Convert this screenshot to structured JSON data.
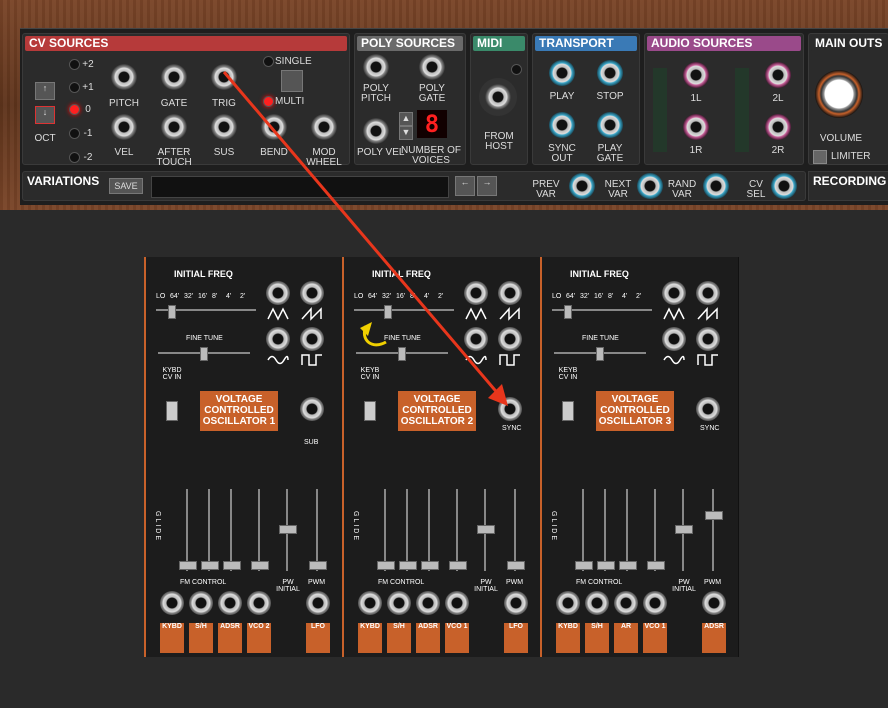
{
  "cv_sources": {
    "title": "CV SOURCES",
    "oct_label": "OCT",
    "oct_values": [
      "+2",
      "+1",
      "0",
      "-1",
      "-2"
    ],
    "oct_selected": "0",
    "row1": [
      "PITCH",
      "GATE",
      "TRIG"
    ],
    "row2": [
      "VEL",
      "AFTER TOUCH",
      "SUS",
      "BEND",
      "MOD WHEEL"
    ],
    "single_label": "SINGLE",
    "multi_label": "MULTI",
    "mode_selected": "MULTI"
  },
  "poly_sources": {
    "title": "POLY SOURCES",
    "jacks": [
      "POLY PITCH",
      "POLY GATE",
      "POLY VEL"
    ],
    "voices_label": "NUMBER OF VOICES",
    "voices_value": "8"
  },
  "midi": {
    "title": "MIDI",
    "from_host": "FROM HOST"
  },
  "transport": {
    "title": "TRANSPORT",
    "jacks": [
      "PLAY",
      "STOP",
      "SYNC OUT",
      "PLAY GATE"
    ]
  },
  "audio_sources": {
    "title": "AUDIO SOURCES",
    "jacks": [
      "1L",
      "2L",
      "1R",
      "2R"
    ]
  },
  "main_outs": {
    "title": "MAIN OUTS",
    "volume": "VOLUME",
    "limiter": "LIMITER"
  },
  "variations": {
    "title": "VARIATIONS",
    "save": "SAVE",
    "jacks": [
      "PREV VAR",
      "NEXT VAR",
      "RAND VAR",
      "CV SEL"
    ]
  },
  "recording": {
    "title": "RECORDING"
  },
  "colors": {
    "cv": "#b63a3a",
    "poly": "#6a6a6a",
    "midi": "#3a8a6a",
    "transport": "#3a7ab6",
    "audio": "#9a4a8a",
    "accent": "#c8612a",
    "arrow": "#e8361c",
    "yellow": "#f0d000"
  },
  "vco_panels": [
    {
      "initial_freq": "INITIAL FREQ",
      "ranges": [
        "LO",
        "64'",
        "32'",
        "16'",
        "8'",
        "4'",
        "2'"
      ],
      "fine_tune": "FINE TUNE",
      "kybd": "KYBD CV IN",
      "title": "VOLTAGE CONTROLLED OSCILLATOR 1",
      "extra": "SUB",
      "glide": "GLIDE",
      "fm_control": "FM CONTROL",
      "pw_initial": "PW INITIAL",
      "pwm": "PWM",
      "fm_sources": [
        "KYBD",
        "S/H",
        "ADSR",
        "VCO 2"
      ],
      "pwm_source": "LFO"
    },
    {
      "initial_freq": "INITIAL FREQ",
      "ranges": [
        "LO",
        "64'",
        "32'",
        "16'",
        "8'",
        "4'",
        "2'"
      ],
      "fine_tune": "FINE TUNE",
      "kybd": "KEYB CV IN",
      "title": "VOLTAGE CONTROLLED OSCILLATOR 2",
      "extra": "SYNC",
      "glide": "GLIDE",
      "fm_control": "FM CONTROL",
      "pw_initial": "PW INITIAL",
      "pwm": "PWM",
      "fm_sources": [
        "KYBD",
        "S/H",
        "ADSR",
        "VCO 1"
      ],
      "pwm_source": "LFO"
    },
    {
      "initial_freq": "INITIAL FREQ",
      "ranges": [
        "LO",
        "64'",
        "32'",
        "16'",
        "8'",
        "4'",
        "2'"
      ],
      "fine_tune": "FINE TUNE",
      "kybd": "KEYB CV IN",
      "title": "VOLTAGE CONTROLLED OSCILLATOR 3",
      "extra": "SYNC",
      "glide": "GLIDE",
      "fm_control": "FM CONTROL",
      "pw_initial": "PW INITIAL",
      "pwm": "PWM",
      "fm_sources": [
        "KYBD",
        "S/H",
        "AR",
        "VCO 1"
      ],
      "pwm_source": "ADSR"
    }
  ]
}
